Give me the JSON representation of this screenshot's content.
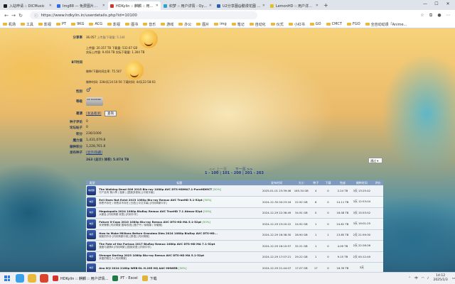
{
  "browser": {
    "tabs": [
      {
        "label": "入站申请 :: DICMusic",
        "color": "#1f1f1f",
        "active": false
      },
      {
        "label": "Img88 — 免费图片存取/上传",
        "color": "#2b6ee5",
        "active": false
      },
      {
        "label": "HDKylin :: 麒麟 :: 用户详情",
        "color": "#d2342a",
        "active": true
      },
      {
        "label": "织梦 :: 用户详情 - Oyasumi",
        "color": "#2aa1d2",
        "active": false
      },
      {
        "label": "U2分享園@動漫花園 :: 用户",
        "color": "#2b5fb0",
        "active": false
      },
      {
        "label": "LemonHD :: 用户详情 - Lu",
        "color": "#e0c020",
        "active": false
      }
    ],
    "new_tab": "+",
    "url": "https://www.hdkylin.in/userdetails.php?id=10100",
    "bookmarks": [
      "机场",
      "工具",
      "影视",
      "PT",
      "9KG",
      "ACG",
      "影视",
      "图书",
      "音乐",
      "游戏",
      "办公",
      "图片",
      "img",
      "笔记",
      "自动化",
      "仪式",
      "小红书",
      "GO",
      "CMCT",
      "FGO",
      "全自动动漫「Anime..."
    ]
  },
  "profile": {
    "share_rate_label": "分享率",
    "share_rate_value": "36.057",
    "share_extra": "上传量/下载量: 5.144",
    "upload_line": "上传量: 20.357 TB",
    "download_line": "下载量: 532.67 GB",
    "real_upload": "实际上传量: 9.456 TB",
    "real_download": "实际下载量: 1.304 TB",
    "seed_label": "BT时间",
    "seed_ratio": "做种/下载时间比率: 75.507",
    "seed_time": "做种时间: 336d天14:10:56",
    "leech_time": "下载时间: 4d天22:58:03",
    "gender_label": "性别",
    "gender_value": "♂",
    "class_label": "等级",
    "class_badge": "VIP DIAMOND",
    "invite_label": "邀请",
    "invite_value": "[发送邀请]",
    "invite_button": "查询",
    "seeding_label": "种子评论",
    "seeding_value": "0",
    "forum_label": "论坛帖子",
    "forum_value": "0",
    "bonus_label": "积分",
    "bonus_value": "236/1000",
    "magic_label": "魔力值",
    "magic_value": "1,431,079.8",
    "earn_label": "做种积分",
    "earn_value": "1,228,761.8",
    "seedtorrents_label": "发布种子",
    "seedtorrents_value": "[显示/隐藏]",
    "count_line": "263 (总计) 体积: 5.874 TB",
    "sort_select": "通过"
  },
  "pager": {
    "prev": "<< 上一页",
    "next": "下一页 >>",
    "pages": "1 - 100 | 101 - 200 | 201 - 263"
  },
  "table": {
    "headers": [
      "类型",
      "标题",
      "发布时间",
      "大小",
      "种子",
      "下载",
      "完成",
      "做种时间",
      "评价"
    ],
    "rows": [
      {
        "cat": "电视剧",
        "title": "The Walking Dead S06 2015 Blu-ray 1080p AVC DTS-HDMA7.1-PureHDMCT",
        "tag": "[50%]",
        "sub": "行尸走肉 第六季 | 独家 | [国英多音轨] [中英字幕]",
        "date": "2025-01-01 23:39:46",
        "size": "165.34 GB",
        "seed": "4",
        "leech": "0",
        "done": "2.24 TB",
        "time": "3天 13:25:42"
      },
      {
        "cat": "电影",
        "title": "Evil Does Not Exist 2023 1080p Blu-ray Remux AVC TrueHD 5.1-52pt",
        "tag": "[50%]",
        "sub": "邪恶不存在 / 邪恶并不存在 [日语] [中文字幕] [内封简繁中字]",
        "date": "2024-12-30 00:23:16",
        "size": "22.92 GB",
        "seed": "6",
        "leech": "0",
        "done": "14.11 TB",
        "time": "3天 12:53:04"
      },
      {
        "cat": "电影",
        "title": "Megalopolis 2024 1080p BluRay Remux AVC TrueHD 7.1 Atmos-52pt",
        "tag": "[50%]",
        "sub": "大都会 [内封简繁 双语] [内封中字]",
        "date": "2024-12-29 22:36:49",
        "size": "34.91 GB",
        "seed": "0",
        "leech": "0",
        "done": "16.08 TB",
        "time": "3天 15:53:52"
      },
      {
        "cat": "电影",
        "title": "Future X-Cops 2010 1080p Blu-ray Remux AVC DTS-HD MA 5.1-52pt",
        "tag": "[50%]",
        "sub": "未来警察 [内封简繁 国粤双语] [甄子丹 / 徐熙娣 / 孙耀威]",
        "date": "2024-12-29 23:20:22",
        "size": "24.92 GB",
        "seed": "1",
        "leech": "0",
        "done": "24.81 TB",
        "time": "3天 19:01:25"
      },
      {
        "cat": "电影",
        "title": "How to Make Millions Before Grandma Dies 2024 1080p BluRay AVC DTS-HD...",
        "tag": "",
        "sub": "姥姥的外孙 [内封简繁中英] [泰语] [内封简繁]",
        "date": "2024-12-29 16:38:30",
        "size": "28.90 GB",
        "seed": "1",
        "leech": "1",
        "done": "13.85 TB",
        "time": "2天 21:59:30"
      },
      {
        "cat": "电影",
        "title": "The Fate of the Furious 2017 BluRay Remux 1080p AVC DTS-HD MA 7.1-52pt",
        "tag": "",
        "sub": "速度与激情8 [内封简繁] [国英双语] [内封中字]",
        "date": "2024-12-29 16:10:57",
        "size": "32.21 GB",
        "seed": "1",
        "leech": "0",
        "done": "4.09 TB",
        "time": "2天 22:26:26"
      },
      {
        "cat": "电影",
        "title": "Strange Darling 2023 1080p Blu-ray Remux AVC DTS-HD MA 5.1-52pt",
        "tag": "",
        "sub": "亲爱的陌生人 [内封简繁]",
        "date": "2024-12-29 17:07:21",
        "size": "29.22 GB",
        "seed": "1",
        "leech": "0",
        "done": "9.15 TB",
        "time": "2天 00:12:49"
      },
      {
        "cat": "电影",
        "title": "Ano N'Ji 2024 2160p WEB-DL H.265 HQ AAC-HHWEB",
        "tag": "[50%]",
        "sub": "",
        "date": "2024-12-29 21:44:07",
        "size": "17.07 GB",
        "seed": "17",
        "leech": "0",
        "done": "16.39 TB",
        "time": "3天 "
      }
    ]
  },
  "taskbar": {
    "apps": [
      {
        "label": "HDKylin :: 麒麟 :: 用户详情...",
        "color": "#d2342a"
      },
      {
        "label": "PT - Excel",
        "color": "#1e7b45"
      },
      {
        "label": "下载",
        "color": "#e0b33a"
      }
    ],
    "lang": "中",
    "time": "14:12",
    "date": "2025/1/3"
  }
}
